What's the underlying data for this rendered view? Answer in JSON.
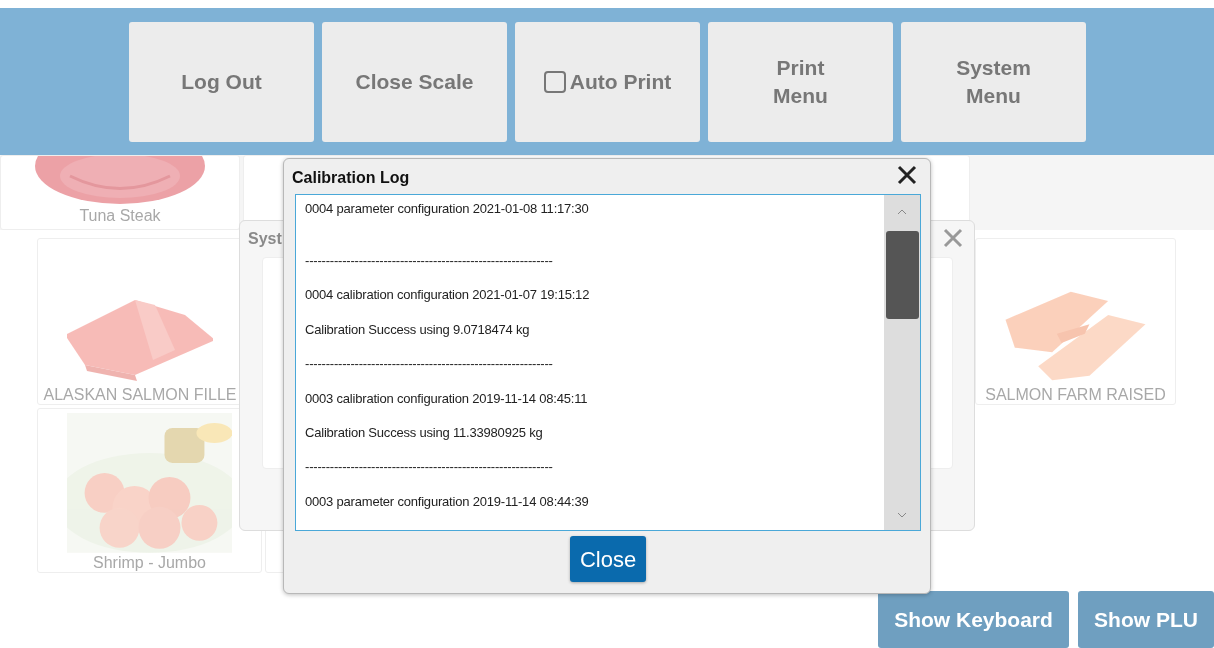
{
  "toolbar": {
    "buttons": [
      {
        "kind": "button",
        "label": "Log Out"
      },
      {
        "kind": "button",
        "label": "Close Scale"
      },
      {
        "kind": "checkbox",
        "label": "Auto Print",
        "checked": false
      },
      {
        "kind": "button",
        "label": "Print\nMenu"
      },
      {
        "kind": "button",
        "label": "System\nMenu"
      }
    ]
  },
  "products": [
    {
      "label": "Tuna Steak"
    },
    {
      "label": "ALASKAN SALMON FILLE"
    },
    {
      "label": "SALMON FARM RAISED"
    },
    {
      "label": "Shrimp - Jumbo"
    }
  ],
  "system_dialog": {
    "title": "Syst"
  },
  "calibration_dialog": {
    "title": "Calibration Log",
    "log_lines": [
      "0004 parameter configuration 2021-01-08 11:17:30",
      "------------------------------------------------------------",
      "0004 calibration configuration 2021-01-07 19:15:12",
      "Calibration Success using 9.0718474 kg",
      "------------------------------------------------------------",
      "0003 calibration configuration 2019-11-14 08:45:11",
      "Calibration Success using 11.33980925 kg",
      "------------------------------------------------------------",
      "0003 parameter configuration 2019-11-14 08:44:39"
    ],
    "close_button": "Close"
  },
  "bottom_buttons": [
    "Show Keyboard",
    "Show PLU"
  ]
}
